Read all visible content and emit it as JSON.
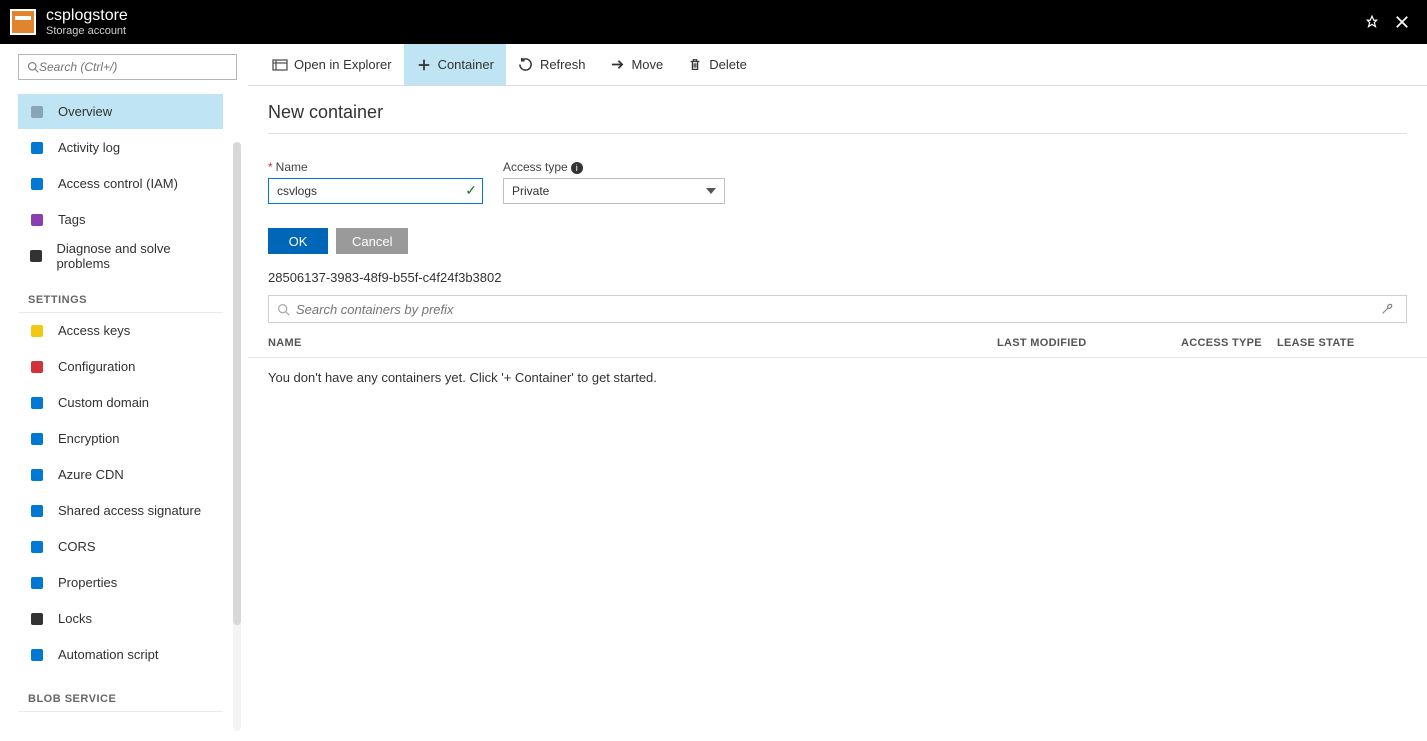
{
  "header": {
    "title": "csplogstore",
    "subtitle": "Storage account"
  },
  "sidebar": {
    "search_placeholder": "Search (Ctrl+/)",
    "items": [
      {
        "icon": "overview-icon",
        "label": "Overview",
        "active": true,
        "color": "#89a5b8"
      },
      {
        "icon": "log-icon",
        "label": "Activity log",
        "color": "#0078d4"
      },
      {
        "icon": "iam-icon",
        "label": "Access control (IAM)",
        "color": "#0078d4"
      },
      {
        "icon": "tag-icon",
        "label": "Tags",
        "color": "#8a3fb0"
      },
      {
        "icon": "diagnose-icon",
        "label": "Diagnose and solve problems",
        "color": "#333"
      }
    ],
    "sections": [
      {
        "title": "SETTINGS",
        "items": [
          {
            "icon": "key-icon",
            "label": "Access keys",
            "color": "#f2c811"
          },
          {
            "icon": "config-icon",
            "label": "Configuration",
            "color": "#d13438"
          },
          {
            "icon": "domain-icon",
            "label": "Custom domain",
            "color": "#0078d4"
          },
          {
            "icon": "lock-icon",
            "label": "Encryption",
            "color": "#0078d4"
          },
          {
            "icon": "cdn-icon",
            "label": "Azure CDN",
            "color": "#0078d4"
          },
          {
            "icon": "sas-icon",
            "label": "Shared access signature",
            "color": "#0078d4"
          },
          {
            "icon": "cors-icon",
            "label": "CORS",
            "color": "#0078d4"
          },
          {
            "icon": "props-icon",
            "label": "Properties",
            "color": "#0078d4"
          },
          {
            "icon": "padlock-icon",
            "label": "Locks",
            "color": "#333"
          },
          {
            "icon": "script-icon",
            "label": "Automation script",
            "color": "#0078d4"
          }
        ]
      },
      {
        "title": "BLOB SERVICE",
        "items": []
      }
    ]
  },
  "toolbar": {
    "open_explorer": "Open in Explorer",
    "container": "Container",
    "refresh": "Refresh",
    "move": "Move",
    "delete": "Delete"
  },
  "panel": {
    "title": "New container",
    "name_label": "Name",
    "name_value": "csvlogs",
    "access_label": "Access type",
    "access_value": "Private",
    "ok": "OK",
    "cancel": "Cancel"
  },
  "subscription_id": "28506137-3983-48f9-b55f-c4f24f3b3802",
  "list": {
    "search_placeholder": "Search containers by prefix",
    "columns": {
      "name": "NAME",
      "last_modified": "LAST MODIFIED",
      "access_type": "ACCESS TYPE",
      "lease_state": "LEASE STATE"
    },
    "empty_message": "You don't have any containers yet. Click '+ Container' to get started."
  }
}
